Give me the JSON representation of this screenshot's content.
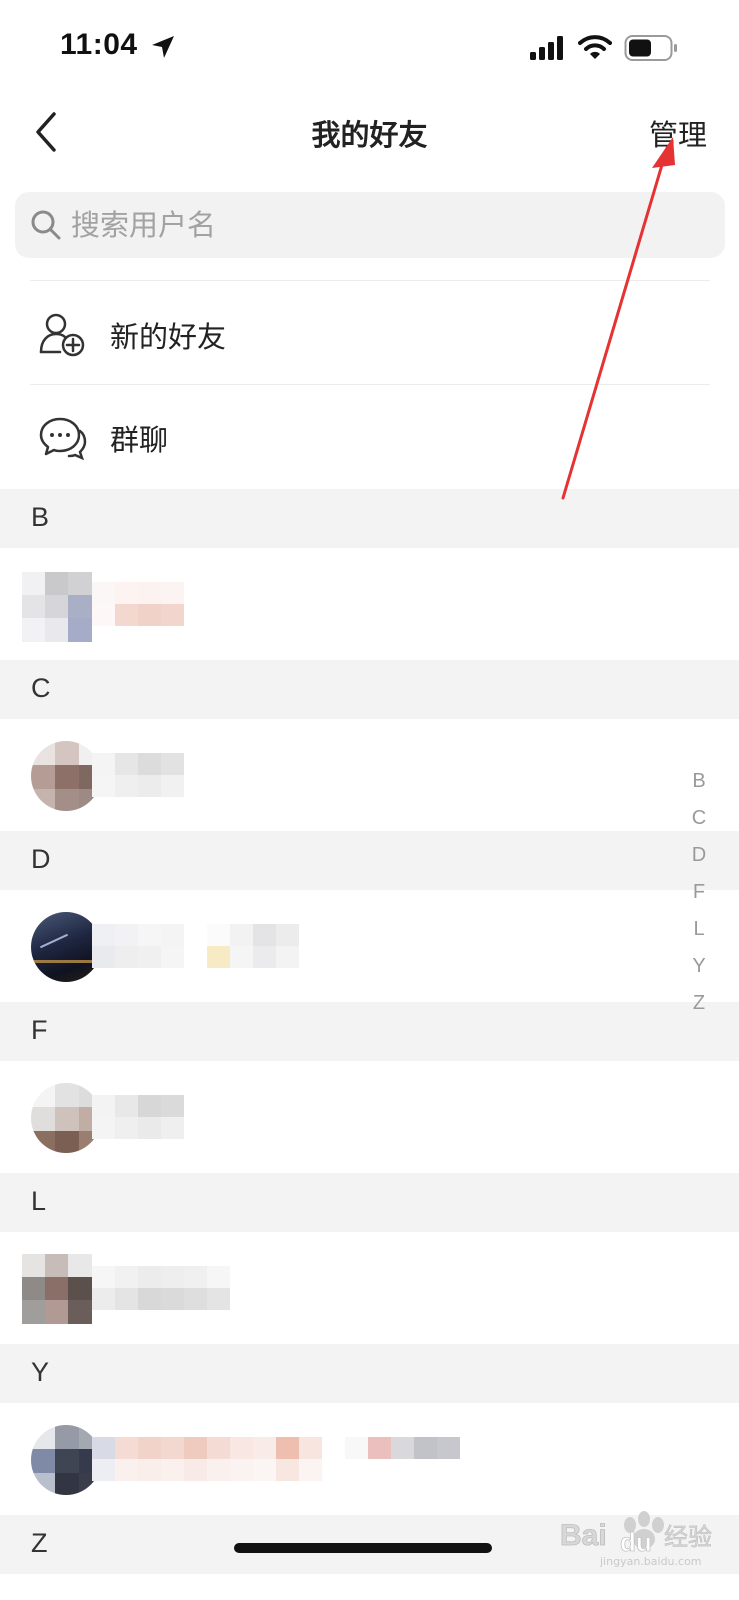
{
  "status_bar": {
    "time": "11:04"
  },
  "nav": {
    "title": "我的好友",
    "manage_label": "管理"
  },
  "search": {
    "placeholder": "搜索用户名"
  },
  "menu": {
    "new_friends": "新的好友",
    "group_chat": "群聊"
  },
  "sections": [
    "B",
    "C",
    "D",
    "F",
    "L",
    "Y",
    "Z"
  ],
  "index_letters": [
    "B",
    "C",
    "D",
    "F",
    "L",
    "Y",
    "Z"
  ],
  "annotation_color": "#e53232",
  "watermark": {
    "brand": "Bai du 经验",
    "url": "jingyan.baidu.com"
  }
}
